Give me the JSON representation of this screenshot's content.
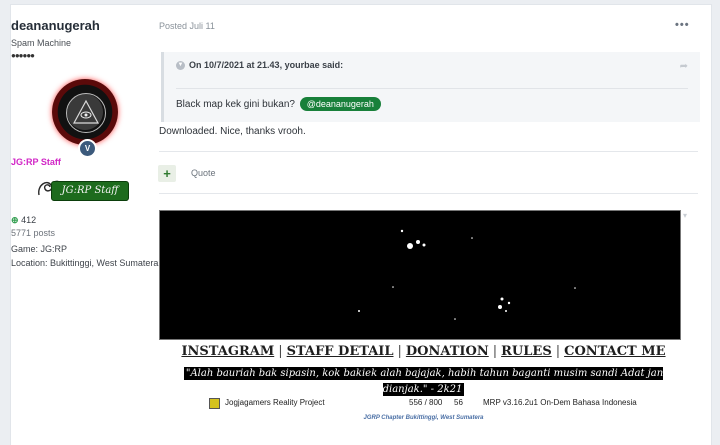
{
  "author": {
    "username": "deananugerah",
    "rank": "Spam Machine",
    "pips": "●●●●●●",
    "group": "JG:RP Staff",
    "staff_image_text": "JG:RP Staff",
    "reputation": "412",
    "posts": "5771 posts",
    "game": "Game: JG:RP",
    "location": "Location: Bukittinggi, West Sumatera",
    "badge_letter": "V"
  },
  "post": {
    "posted": "Posted Juli 11",
    "more_icon": "ellipsis-icon",
    "quote_header": "On 10/7/2021 at 21.43, yourbae said:",
    "quote_body": "Black map kek gini bukan?",
    "mention": "@deananugerah",
    "reply": "Downloaded. Nice, thanks vrooh.",
    "quote_button": "Quote"
  },
  "signature": {
    "links": [
      "INSTAGRAM",
      "STAFF DETAIL",
      "DONATION",
      "RULES",
      "CONTACT ME"
    ],
    "separator": "|",
    "motto": "\"Alah bauriah bak sipasin, kok bakiek alah bajajak, habih tahun baganti musim sandi Adat jan dianjak.\" - 2k21",
    "server_name": "Jogjagamers Reality Project",
    "server_players": "556 / 800",
    "server_ping": "56",
    "server_mode": "MRP v3.16.2u1 On-Dem Bahasa Indonesia",
    "chapter": "JGRP Chapter Bukittinggi, West Sumatera"
  },
  "colors": {
    "group": "#d126c6",
    "mention_bg": "#18803a",
    "reputation": "#2e9c4c"
  }
}
